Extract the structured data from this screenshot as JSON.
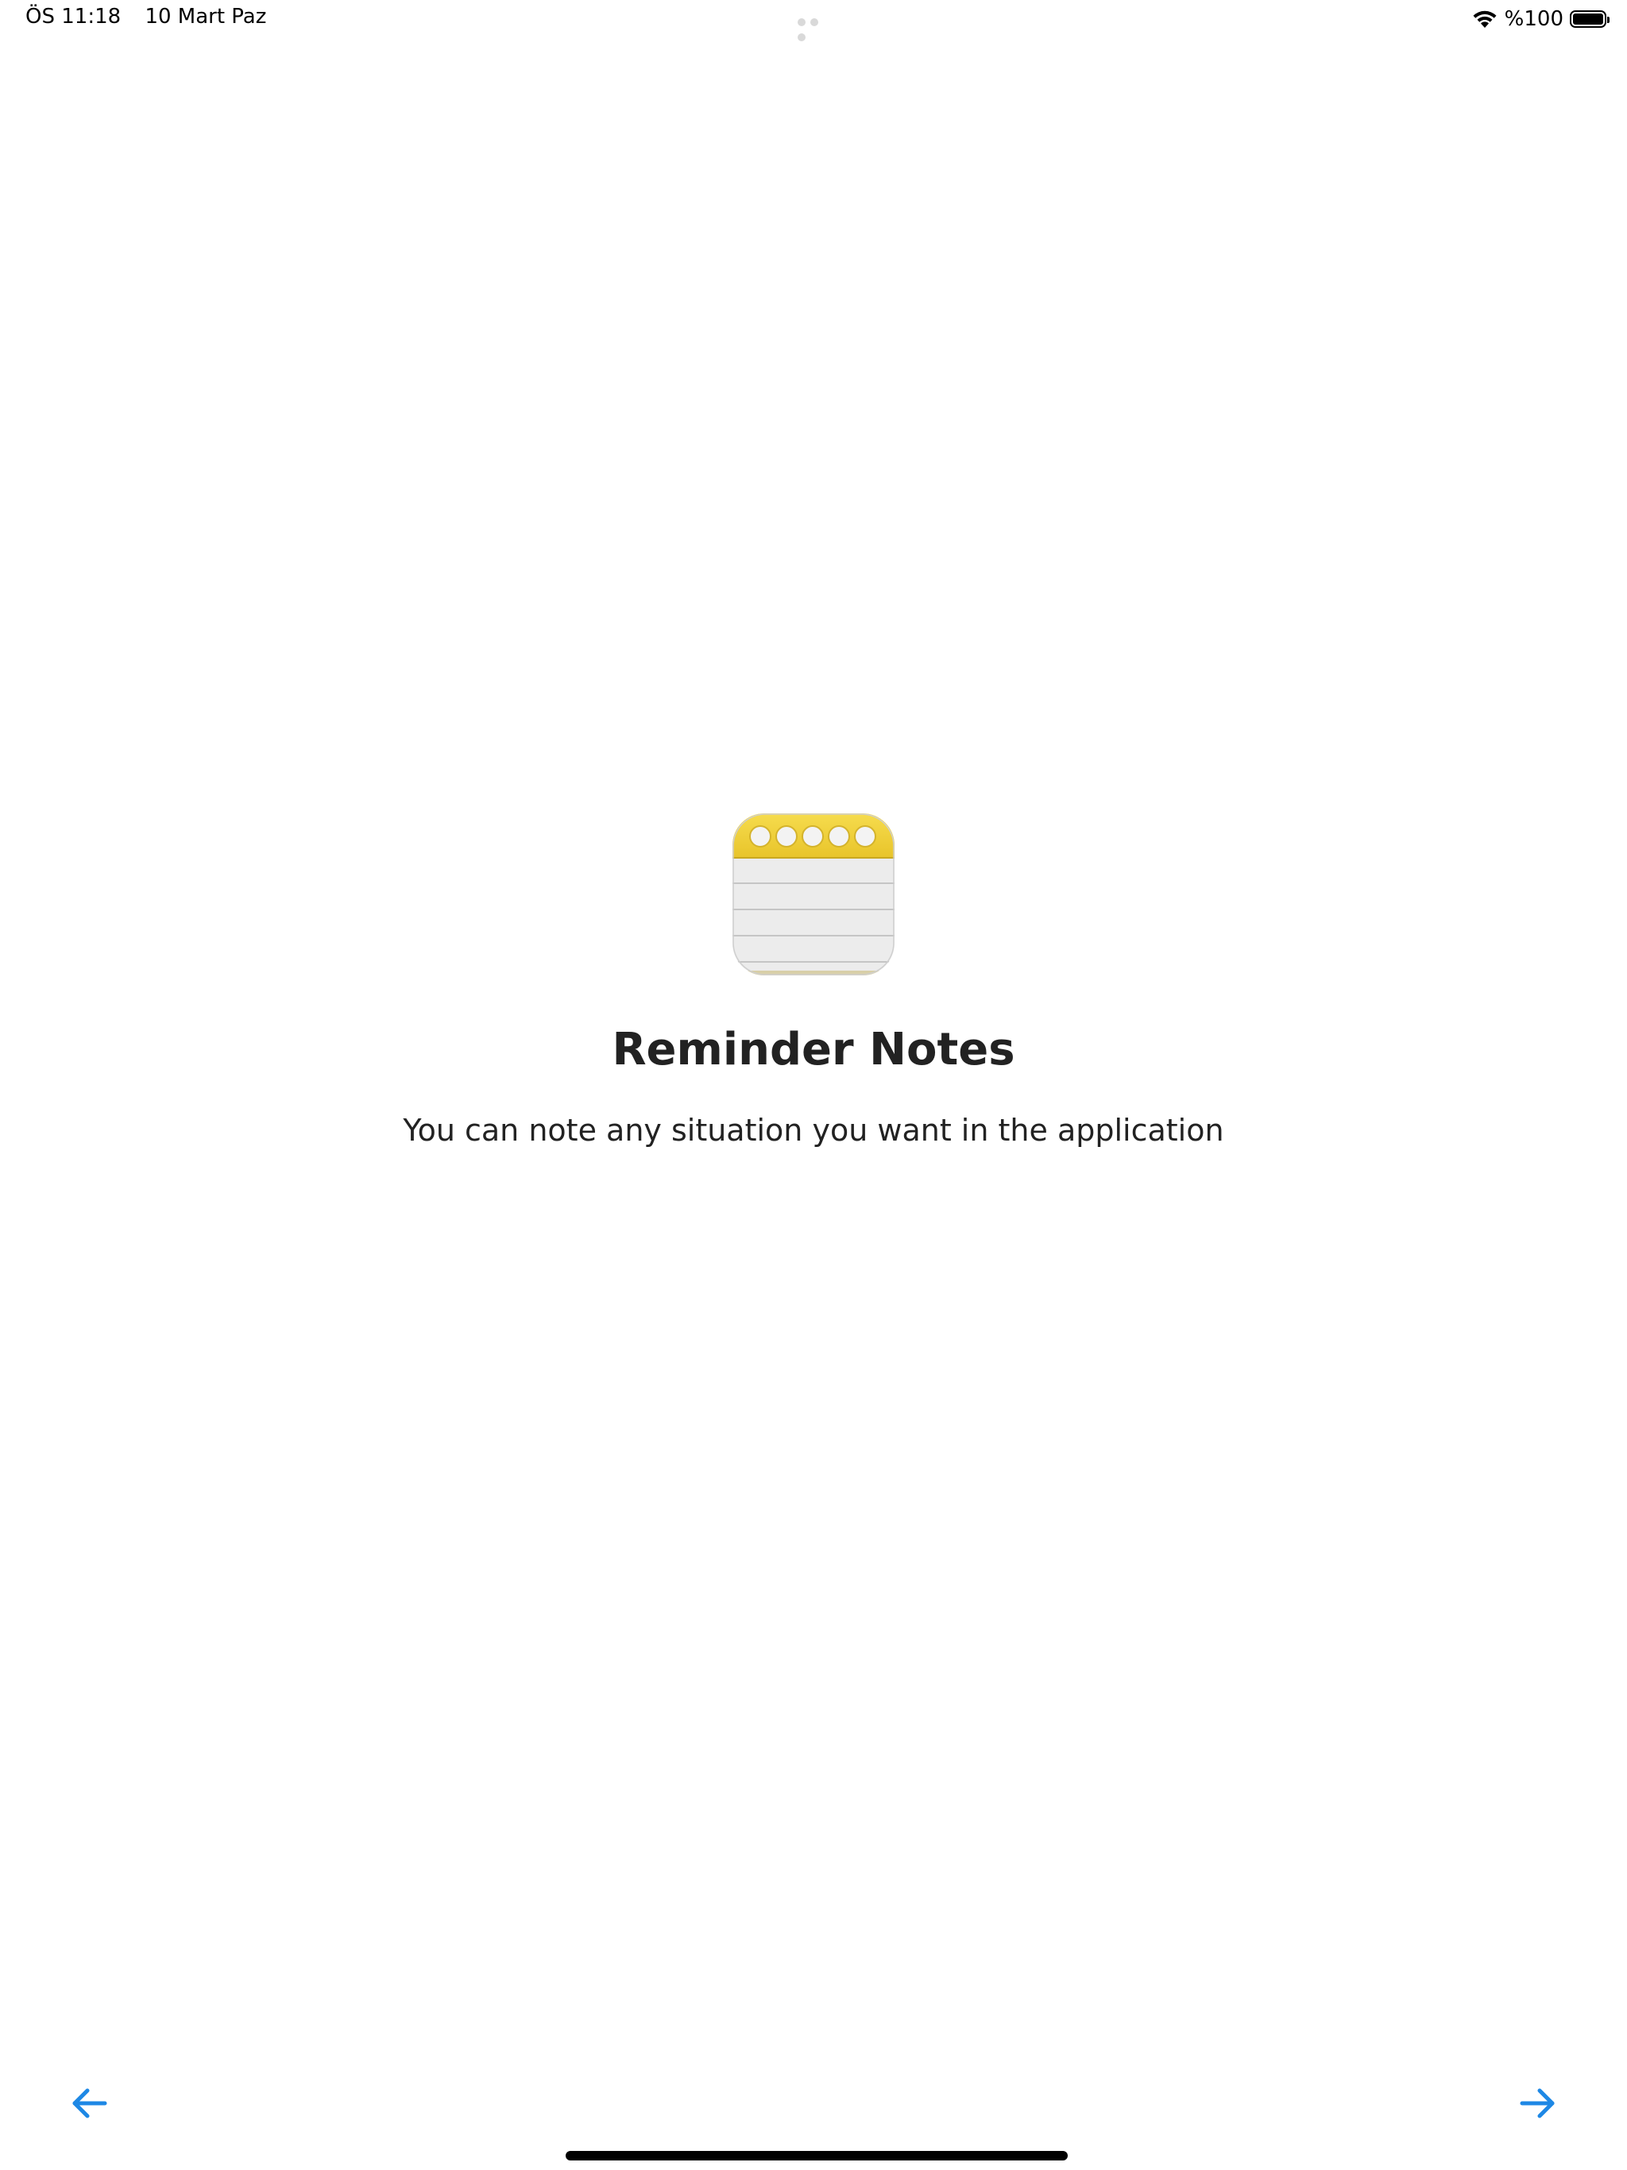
{
  "status_bar": {
    "time": "ÖS 11:18",
    "date": "10 Mart Paz",
    "battery_text": "%100",
    "battery_level": 1.0
  },
  "onboarding": {
    "icon": "notepad-icon",
    "title": "Reminder Notes",
    "description": "You can note any situation you want in the application"
  },
  "navigation": {
    "prev_icon": "arrow-left-icon",
    "next_icon": "arrow-right-icon"
  },
  "colors": {
    "accent": "#1e88e5",
    "text": "#222222",
    "notepad_yellow": "#f2cd3a",
    "notepad_paper": "#ececec"
  }
}
